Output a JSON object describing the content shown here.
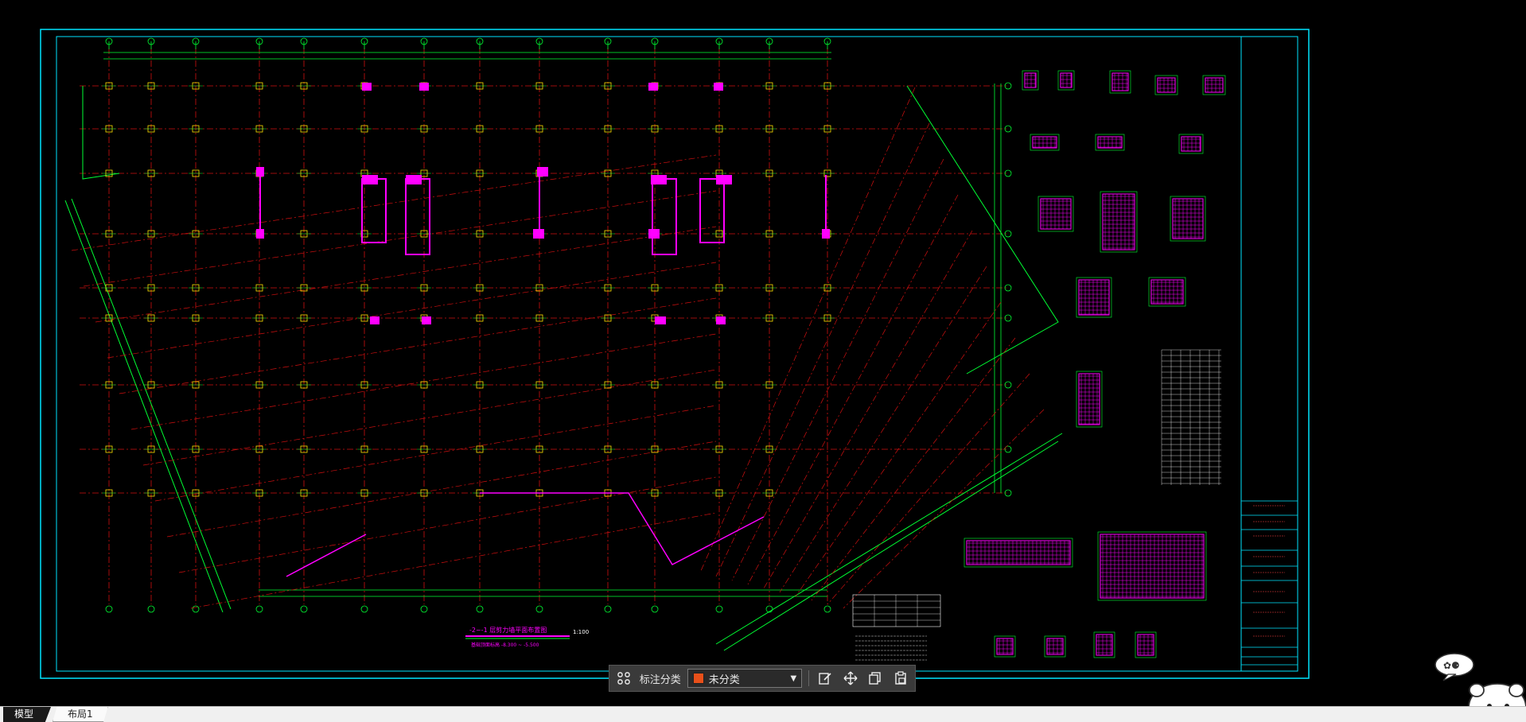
{
  "drawing": {
    "title_text": "-2~-1 层剪力墙平面布置图",
    "title_scale": "1:100",
    "title_subtitle": "基础顶面标高 -8.300 ~ -5.500",
    "border_color": "#00e5ff",
    "grid_color": "#d01010",
    "wall_color": "#ff00ff",
    "dim_color": "#00ff33"
  },
  "toolbar": {
    "grid_icon": "grid-apps-icon",
    "category_label": "标注分类",
    "category_value": "未分类",
    "category_swatch": "#e8501a",
    "edit_icon": "edit-icon",
    "move_icon": "move-icon",
    "copy_icon": "copy-icon",
    "paste_icon": "paste-icon"
  },
  "tabs": [
    {
      "label": "模型",
      "active": true
    },
    {
      "label": "布局1",
      "active": false
    }
  ]
}
